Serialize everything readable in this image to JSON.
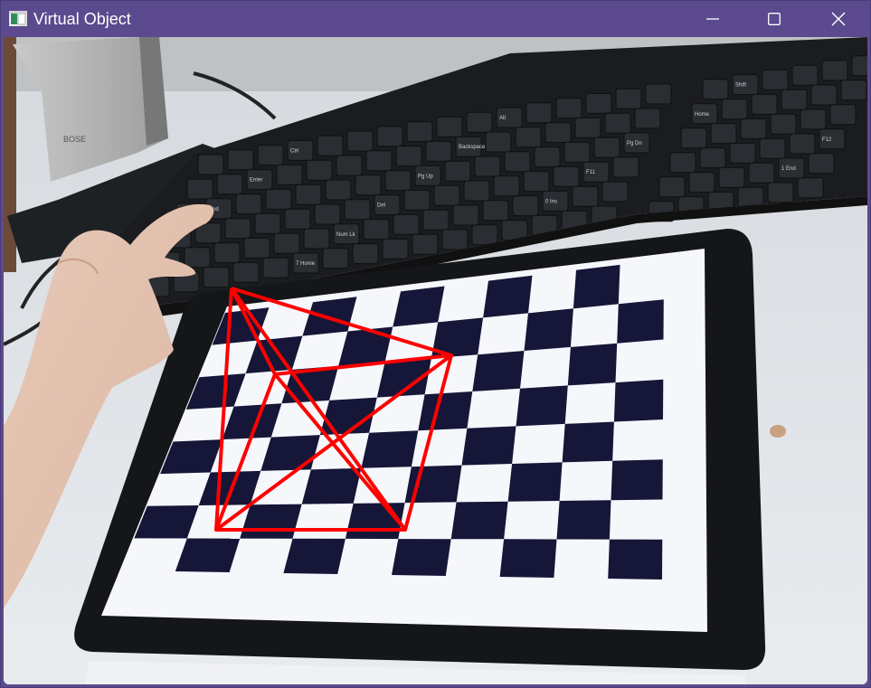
{
  "window": {
    "title": "Virtual Object",
    "controls": {
      "minimize": "minimize-icon",
      "maximize": "maximize-icon",
      "close": "close-icon"
    },
    "colors": {
      "titlebar": "#5b4a8e",
      "title_text": "#ffffff",
      "overlay": "#ff0000"
    }
  },
  "camera": {
    "keyboard_keys": [
      "Ctrl",
      "Alt",
      "Shift",
      "Enter",
      "Backspace",
      "Home",
      "End",
      "Pg Up",
      "Pg Dn",
      "Ins",
      "Del",
      "F11",
      "F12",
      "Num Lk",
      "0 Ins",
      "1 End",
      "7 Home"
    ],
    "icons": {
      "overlay_pyramid": "pyramid-wireframe-icon"
    }
  }
}
